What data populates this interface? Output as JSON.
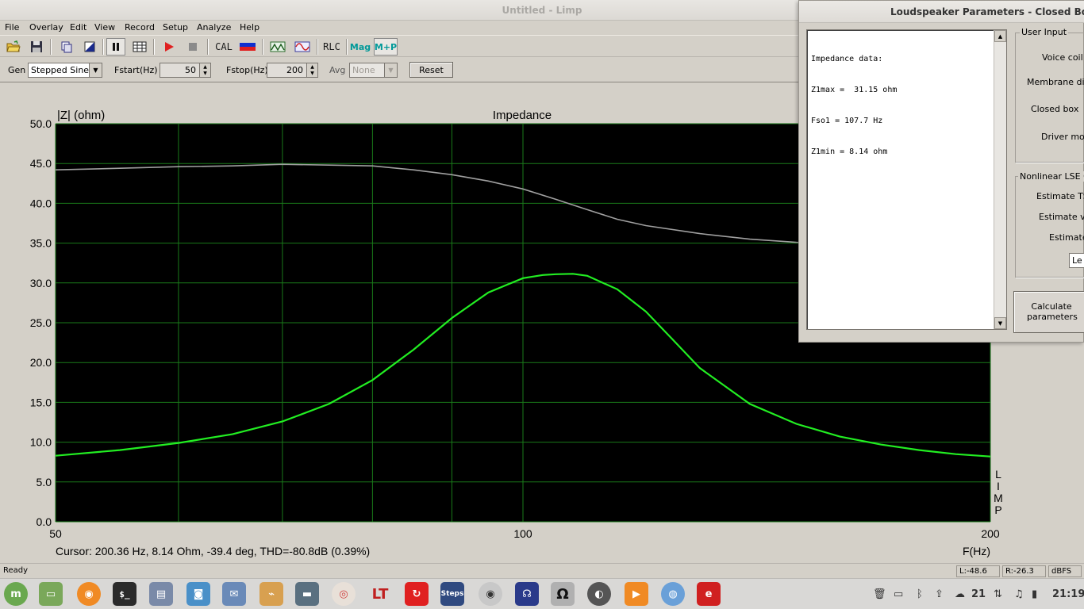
{
  "window": {
    "title": "Untitled - Limp"
  },
  "menu": [
    "File",
    "Overlay",
    "Edit",
    "View",
    "Record",
    "Setup",
    "Analyze",
    "Help"
  ],
  "toolbar": {
    "cal_label": "CAL",
    "rlc_label": "RLC",
    "mag_label": "Mag",
    "mp_label": "M+P"
  },
  "genbar": {
    "gen_label": "Gen",
    "gen_value": "Stepped Sine",
    "fstart_label": "Fstart(Hz)",
    "fstart_value": "50",
    "fstop_label": "Fstop(Hz)",
    "fstop_value": "200",
    "avg_label": "Avg",
    "avg_value": "None",
    "reset_label": "Reset"
  },
  "chart_data": {
    "type": "line",
    "title": "Impedance",
    "ylabel": "|Z| (ohm)",
    "xlabel": "F(Hz)",
    "x_scale": "log",
    "xlim": [
      50,
      200
    ],
    "ylim": [
      0,
      50
    ],
    "y_ticks": [
      "50.0",
      "45.0",
      "40.0",
      "35.0",
      "30.0",
      "25.0",
      "20.0",
      "15.0",
      "10.0",
      "5.0",
      "0.0"
    ],
    "x_ticks": [
      "50",
      "100",
      "200"
    ],
    "x_gridlines": [
      50,
      60,
      70,
      80,
      90,
      100,
      200
    ],
    "grid": true,
    "side_label": [
      "L",
      "I",
      "M",
      "P"
    ],
    "colors": {
      "background": "#000000",
      "grid": "#1a7a1a",
      "magnitude": "#22ee22",
      "phase": "#a0a0a0"
    },
    "series": [
      {
        "x": [
          50,
          55,
          60,
          65,
          70,
          75,
          80,
          85,
          90,
          95,
          100,
          103,
          105,
          107.7,
          110,
          115,
          120,
          125,
          130,
          140,
          150,
          160,
          170,
          180,
          190,
          200
        ],
        "values": [
          8.3,
          9.0,
          9.9,
          11.0,
          12.6,
          14.8,
          17.8,
          21.6,
          25.6,
          28.8,
          30.6,
          31.0,
          31.1,
          31.15,
          30.9,
          29.2,
          26.4,
          22.8,
          19.3,
          14.8,
          12.3,
          10.7,
          9.7,
          9.0,
          8.5,
          8.2
        ]
      },
      {
        "x": [
          50,
          55,
          60,
          65,
          70,
          75,
          80,
          85,
          90,
          95,
          100,
          105,
          110,
          115,
          120,
          130,
          140,
          150,
          160,
          170,
          180
        ],
        "values": [
          44.2,
          44.4,
          44.6,
          44.7,
          44.9,
          44.8,
          44.7,
          44.2,
          43.6,
          42.8,
          41.8,
          40.5,
          39.2,
          38.0,
          37.2,
          36.2,
          35.5,
          35.1,
          34.9,
          34.8,
          34.8
        ]
      }
    ]
  },
  "cursor_readout": "Cursor: 200.36 Hz, 8.14 Ohm, -39.4 deg, THD=-80.8dB (0.39%)",
  "status": {
    "left": "Ready",
    "level_l": "L:-48.6",
    "level_r": "R:-26.3",
    "unit": "dBFS"
  },
  "dialog": {
    "title": "Loudspeaker Parameters - Closed Box M",
    "memo_lines": [
      "Impedance data:",
      "Z1max =  31.15 ohm",
      "Fso1 = 107.7 Hz",
      "Z1min = 8.14 ohm"
    ],
    "user_input_title": "User Input",
    "user_input_labels": [
      "Voice coil R",
      "Membrane diar",
      "Closed box",
      "Driver mou"
    ],
    "lse_title": "Nonlinear LSE Op",
    "lse_labels": [
      "Estimate TS",
      "Estimate vo",
      "Estimate"
    ],
    "lse_field": "Le",
    "calc_button": "Calculate parameters"
  },
  "taskbar": {
    "time": "21:19",
    "temp": "21"
  }
}
